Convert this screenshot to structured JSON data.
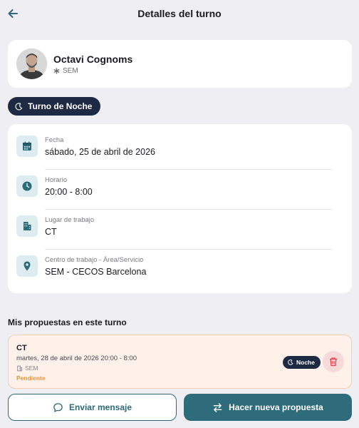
{
  "header": {
    "title": "Detalles del turno",
    "back_icon": "arrow-left-icon"
  },
  "profile": {
    "name": "Octavi Cognoms",
    "organization": "SEM"
  },
  "shift_type": {
    "label": "Turno de Noche",
    "icon": "moon-icon"
  },
  "details": {
    "fecha": {
      "label": "Fecha",
      "value": "sábado, 25 de abril de 2026",
      "icon": "calendar-icon"
    },
    "horario": {
      "label": "Horario",
      "value": "20:00 - 8:00",
      "icon": "clock-icon"
    },
    "lugar": {
      "label": "Lugar de trabajo",
      "value": "CT",
      "icon": "building-icon"
    },
    "centro": {
      "label": "Centro de trabajo - Área/Servicio",
      "value": "SEM - CECOS Barcelona",
      "icon": "location-pin-icon"
    }
  },
  "proposals": {
    "title": "Mis propuestas en este turno",
    "items": [
      {
        "place": "CT",
        "datetime": "martes, 28 de abril de 2026 20:00 - 8:00",
        "organization": "SEM",
        "status": "Pendiente",
        "shift_badge": "Noche"
      }
    ]
  },
  "actions": {
    "send_message": "Enviar mensaje",
    "new_proposal": "Hacer nueva propuesta"
  },
  "colors": {
    "accent": "#2e6b7b",
    "dark_navy": "#1e2a44",
    "pending": "#e8943a",
    "proposal_bg": "#fdf1ea",
    "delete_red": "#e0434a"
  }
}
